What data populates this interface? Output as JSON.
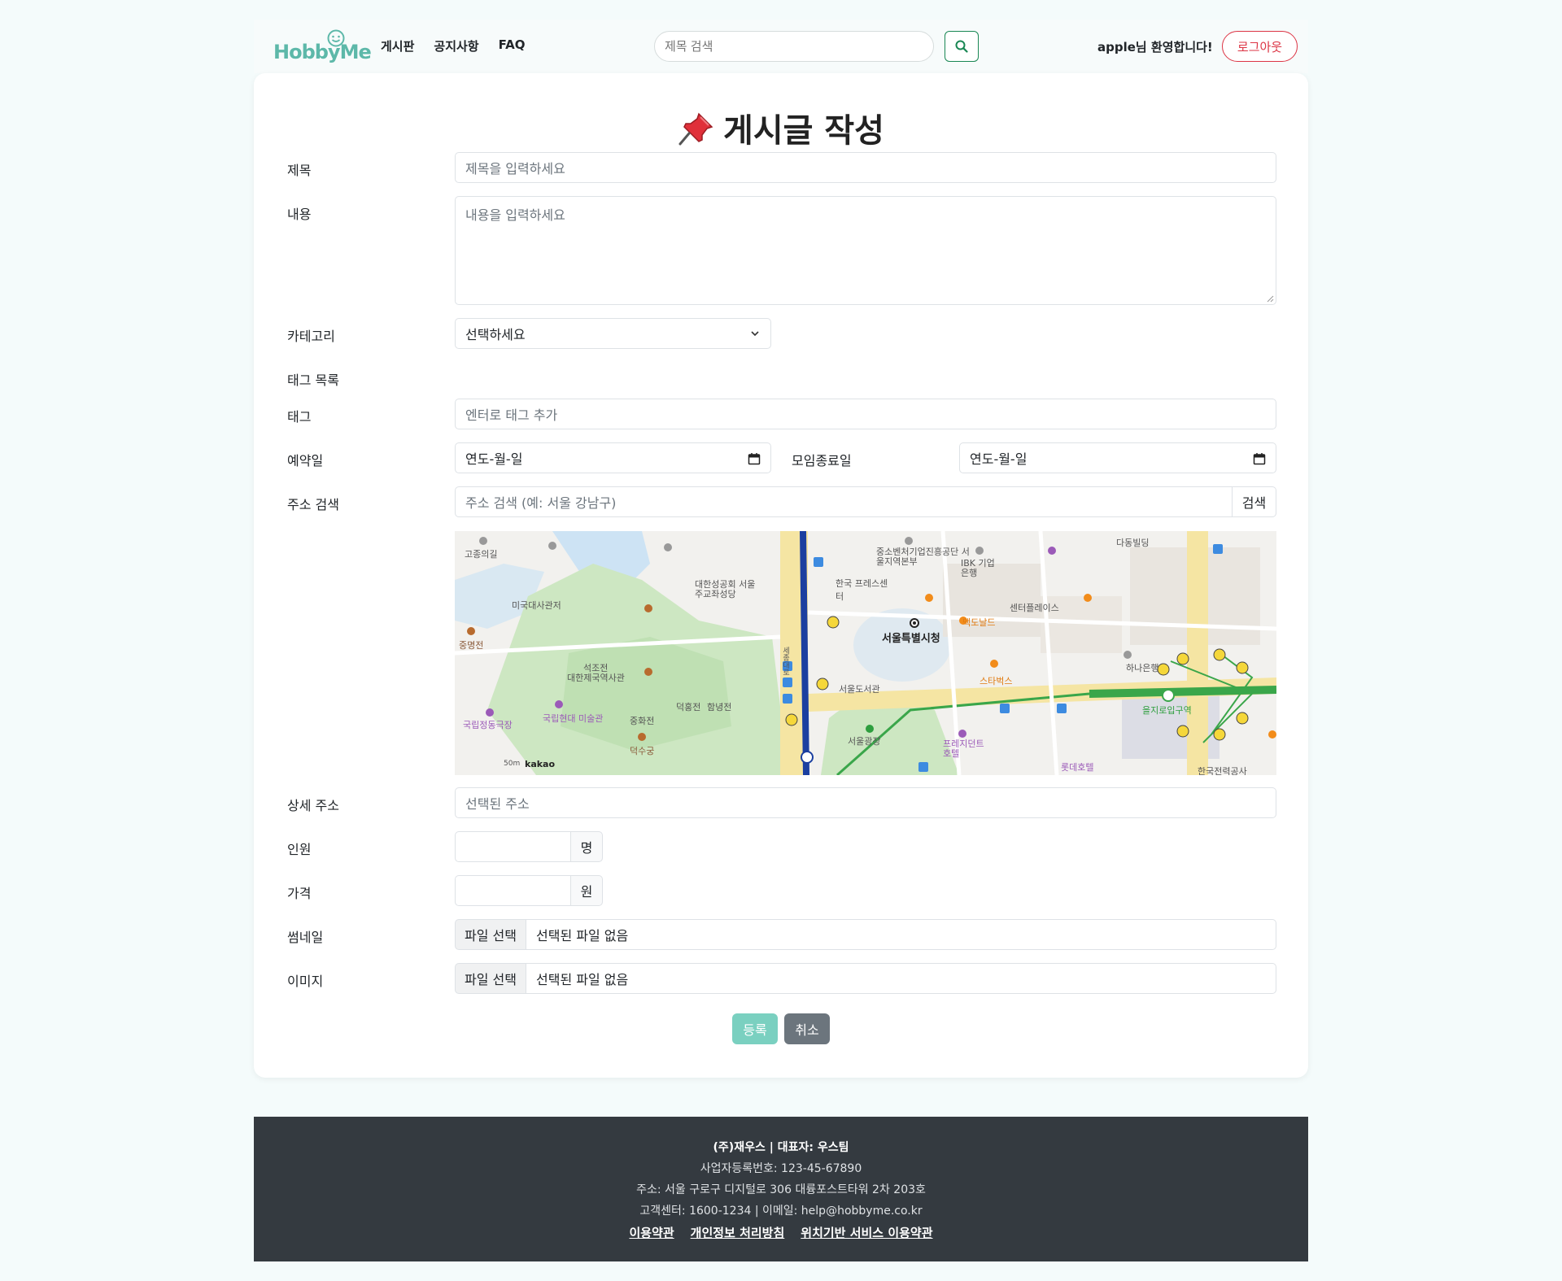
{
  "header": {
    "logo": "HobbyMe",
    "nav": [
      "게시판",
      "공지사항",
      "FAQ"
    ],
    "search_placeholder": "제목 검색",
    "welcome": "apple님 환영합니다!",
    "logout": "로그아웃"
  },
  "form": {
    "title": "게시글 작성",
    "title_label": "제목",
    "title_placeholder": "제목을 입력하세요",
    "content_label": "내용",
    "content_placeholder": "내용을 입력하세요",
    "category_label": "카테고리",
    "category_value": "선택하세요",
    "tag_list_label": "태그 목록",
    "tag_label": "태그",
    "tag_placeholder": "엔터로 태그 추가",
    "reserve_label": "예약일",
    "reserve_value": "연도-월-일",
    "end_label": "모임종료일",
    "end_value": "연도-월-일",
    "addr_label": "주소 검색",
    "addr_placeholder": "주소 검색 (예: 서울 강남구)",
    "addr_button": "검색",
    "detail_label": "상세 주소",
    "detail_placeholder": "선택된 주소",
    "people_label": "인원",
    "people_unit": "명",
    "price_label": "가격",
    "price_unit": "원",
    "thumb_label": "썸네일",
    "image_label": "이미지",
    "file_button": "파일 선택",
    "file_none": "선택된 파일 없음",
    "submit": "등록",
    "cancel": "취소"
  },
  "map": {
    "labels": {
      "city_hall": "서울특별시청",
      "library": "서울도서관",
      "plaza": "서울광장",
      "deoksugung": "덕수궁",
      "seokjojeon": "석조전",
      "museum": "대한제국역사관",
      "seongdang": "대한성공회 서울주교좌성당",
      "press": "한국 프레스센터",
      "sme": "중소벤처기업진흥공단 서울지역본부",
      "ibk": "IBK 기업은행",
      "dadong": "다동빌딩",
      "center_place": "센터플레이스",
      "mcd": "맥도날드",
      "starbucks": "스타벅스",
      "hana": "하나은행",
      "euljiro": "을지로입구역",
      "plaza_hotel": "프레지던트 호텔",
      "lotte": "롯데호텔",
      "kepco": "한국전력공사",
      "gojong": "고종의길",
      "embassy": "미국대사관저",
      "theater": "국립정동극장",
      "mmca": "국립현대 미술관",
      "jungmyeong": "중명전",
      "dukhongjeon": "덕홍전",
      "hamnyeongjeon": "함녕전",
      "junghwajeon": "중화전",
      "sejong": "세종대로",
      "kakao": "kakao",
      "scale": "50m"
    }
  },
  "footer": {
    "company": "(주)재우스 | 대표자: 우스팀",
    "business": "사업자등록번호: 123-45-67890",
    "address": "주소: 서울 구로구 디지털로 306 대륭포스트타워 2차 203호",
    "contact": "고객센터: 1600-1234 | 이메일: help@hobbyme.co.kr",
    "links": [
      "이용약관",
      "개인정보 처리방침",
      "위치기반 서비스 이용약관"
    ]
  },
  "colors": {
    "brand": "#5db8a9",
    "submit": "#7ad0c0",
    "cancel": "#6c757d",
    "logout": "#dc3545",
    "search_btn": "#198754",
    "footer_bg": "#343a40"
  }
}
